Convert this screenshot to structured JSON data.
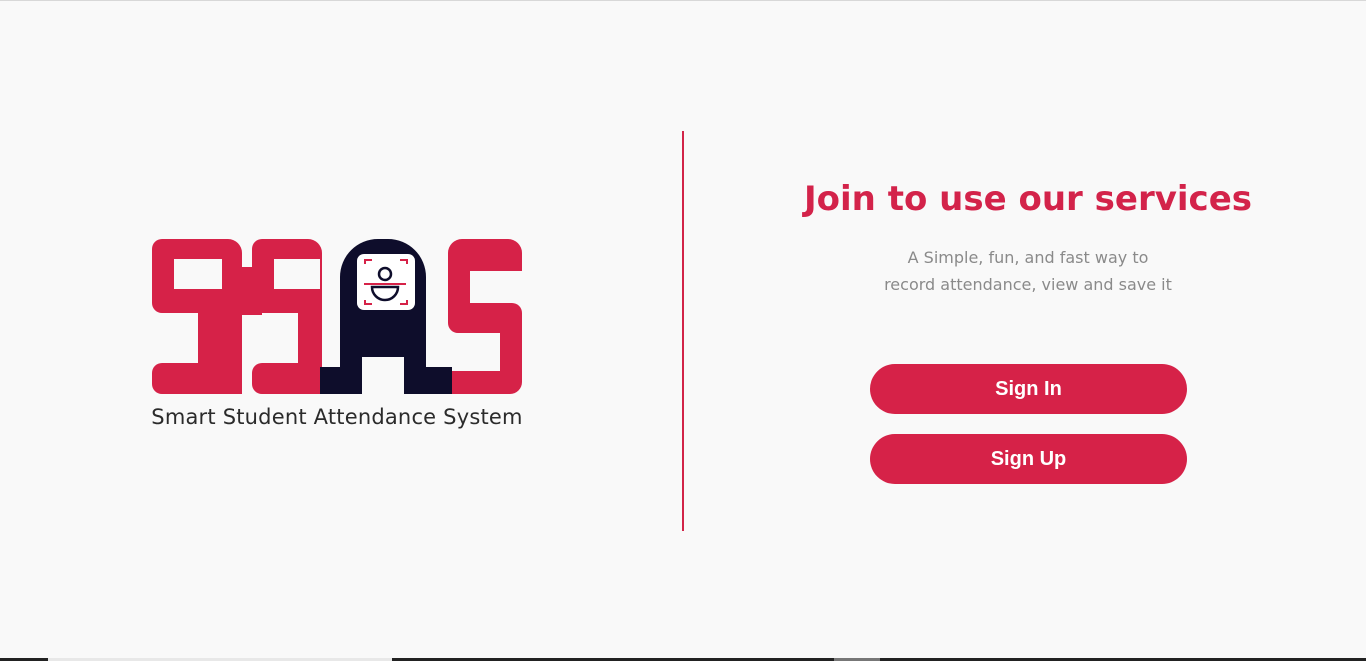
{
  "logo": {
    "icon": "face-scan-icon",
    "caption": "Smart Student Attendance System",
    "colors": {
      "primary": "#d62248",
      "dark": "#0e0d2b"
    }
  },
  "hero": {
    "title": "Join to use our services",
    "subtitle_line1": "A Simple, fun, and fast way to",
    "subtitle_line2": "record attendance, view and save it"
  },
  "actions": {
    "sign_in_label": "Sign In",
    "sign_up_label": "Sign Up"
  },
  "theme": {
    "accent": "#d62248",
    "background": "#f9f9f9",
    "subtitle_color": "#8a8a8a"
  }
}
